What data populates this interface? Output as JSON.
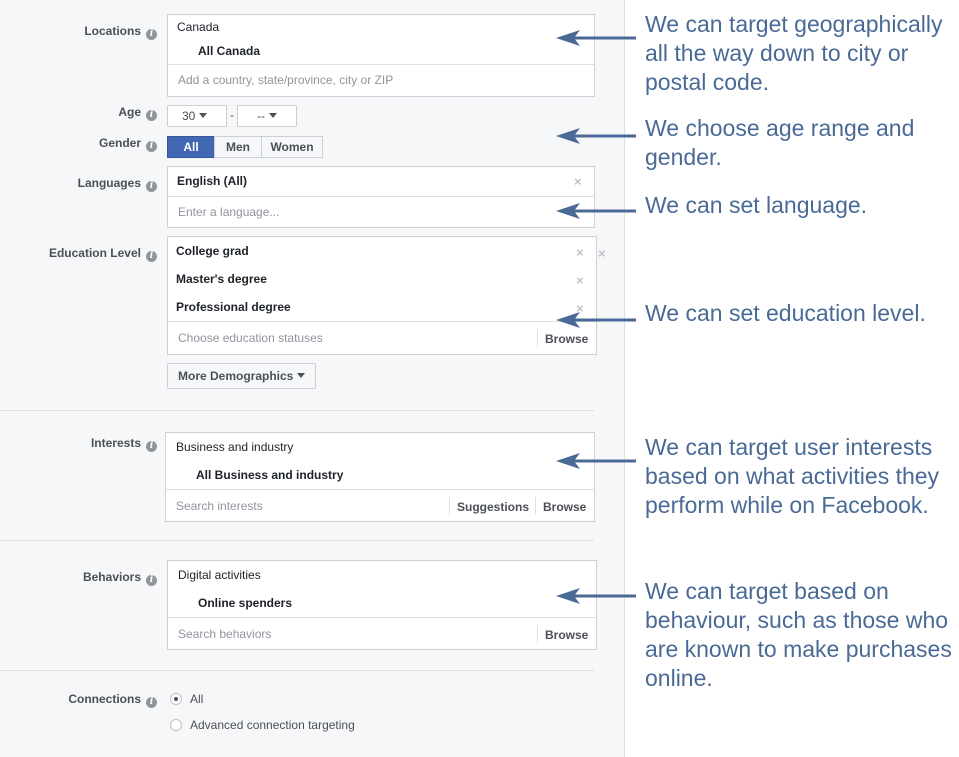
{
  "labels": {
    "locations": "Locations",
    "age": "Age",
    "gender": "Gender",
    "languages": "Languages",
    "education": "Education Level",
    "interests": "Interests",
    "behaviors": "Behaviors",
    "connections": "Connections",
    "info_glyph": "i"
  },
  "locations": {
    "country": "Canada",
    "selection": "All Canada",
    "placeholder": "Add a country, state/province, city or ZIP"
  },
  "age": {
    "min": "30",
    "separator": "-",
    "max": "--"
  },
  "gender": {
    "options": [
      "All",
      "Men",
      "Women"
    ],
    "selected": "All"
  },
  "languages": {
    "selected": "English (All)",
    "placeholder": "Enter a language...",
    "remove": "×"
  },
  "education": {
    "items": [
      "College grad",
      "Master's degree",
      "Professional degree"
    ],
    "placeholder": "Choose education statuses",
    "browse": "Browse",
    "remove": "×"
  },
  "more_demographics": "More Demographics",
  "interests": {
    "category": "Business and industry",
    "selection": "All Business and industry",
    "placeholder": "Search interests",
    "suggestions": "Suggestions",
    "browse": "Browse"
  },
  "behaviors": {
    "category": "Digital activities",
    "selection": "Online spenders",
    "placeholder": "Search behaviors",
    "browse": "Browse"
  },
  "connections": {
    "options": [
      "All",
      "Advanced connection targeting"
    ],
    "selected": "All"
  },
  "annotations": [
    "We can target geographically all the way down to city or postal code.",
    "We choose age range and gender.",
    "We can set language.",
    "We can set education level.",
    "We can target user interests based on what activities they perform while on Facebook.",
    "We can target based on behaviour, such as those who are known to make purchases online."
  ],
  "colors": {
    "annotation_text": "#4a6a96",
    "arrow": "#4a6a96",
    "active_segment": "#4267b2",
    "panel_background": "#f6f7f9"
  }
}
